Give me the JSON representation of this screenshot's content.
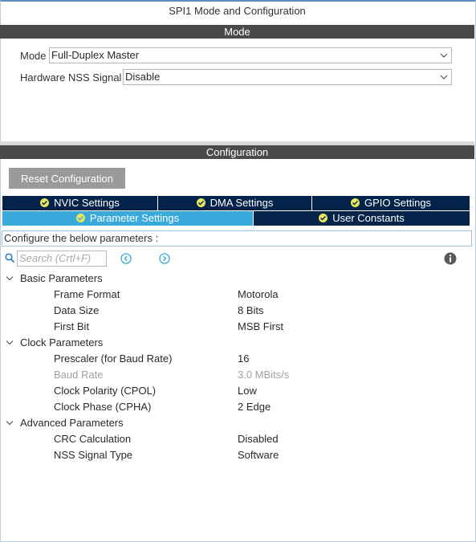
{
  "window": {
    "title": "SPI1 Mode and Configuration"
  },
  "mode_section": {
    "header": "Mode",
    "fields": [
      {
        "label": "Mode",
        "value": "Full-Duplex Master"
      },
      {
        "label": "Hardware NSS Signal",
        "value": "Disable"
      }
    ]
  },
  "config_section": {
    "header": "Configuration",
    "reset_label": "Reset Configuration",
    "tabs_row1": [
      {
        "label": "NVIC Settings"
      },
      {
        "label": "DMA Settings"
      },
      {
        "label": "GPIO Settings"
      }
    ],
    "tabs_row2": [
      {
        "label": "Parameter Settings",
        "active": true
      },
      {
        "label": "User Constants",
        "active": false
      }
    ],
    "description": "Configure the below parameters :",
    "search_placeholder": "Search (Crtl+F)",
    "groups": [
      {
        "name": "Basic Parameters",
        "params": [
          {
            "name": "Frame Format",
            "value": "Motorola"
          },
          {
            "name": "Data Size",
            "value": "8 Bits"
          },
          {
            "name": "First Bit",
            "value": "MSB First"
          }
        ]
      },
      {
        "name": "Clock Parameters",
        "params": [
          {
            "name": "Prescaler (for Baud Rate)",
            "value": "16"
          },
          {
            "name": "Baud Rate",
            "value": "3.0 MBits/s",
            "disabled": true
          },
          {
            "name": "Clock Polarity (CPOL)",
            "value": "Low"
          },
          {
            "name": "Clock Phase (CPHA)",
            "value": "2 Edge"
          }
        ]
      },
      {
        "name": "Advanced Parameters",
        "params": [
          {
            "name": "CRC Calculation",
            "value": "Disabled"
          },
          {
            "name": "NSS Signal Type",
            "value": "Software"
          }
        ]
      }
    ]
  },
  "colors": {
    "band": "#4a4a4a",
    "tab_inactive": "#03234b",
    "tab_active": "#39a9dc",
    "accent": "#39a9dc"
  },
  "icons": [
    "chevron-down-icon",
    "check-circle-icon",
    "search-icon",
    "prev-icon",
    "next-icon",
    "info-icon",
    "collapse-chevron-icon"
  ]
}
